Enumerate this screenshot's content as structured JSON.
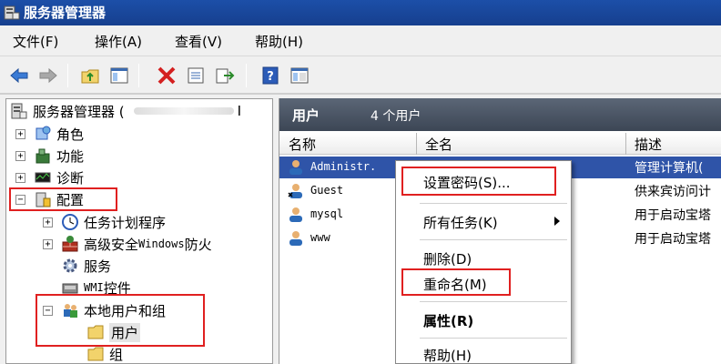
{
  "window": {
    "title": "服务器管理器"
  },
  "menubar": {
    "items": [
      "文件(F)",
      "操作(A)",
      "查看(V)",
      "帮助(H)"
    ]
  },
  "toolbar": {
    "buttons": [
      "back-arrow-icon",
      "forward-arrow-icon",
      "up-folder-icon",
      "show-hide-tree-icon",
      "delete-icon",
      "properties-icon",
      "export-icon",
      "help-icon",
      "view-icon"
    ]
  },
  "tree": {
    "root_label": "服务器管理器 (",
    "root_suffix": "I",
    "items": {
      "roles": "角色",
      "features": "功能",
      "diagnostics": "诊断",
      "configuration": "配置",
      "task_scheduler": "任务计划程序",
      "advanced_firewall_prefix": "高级安全 ",
      "advanced_firewall_mono": "Windows",
      "advanced_firewall_suffix": " 防火",
      "services": "服务",
      "wmi_prefix": "WMI",
      "wmi_suffix": " 控件",
      "local_users_groups": "本地用户和组",
      "users": "用户",
      "groups": "组"
    }
  },
  "right_pane": {
    "header_title": "用户",
    "header_count": "4 个用户",
    "columns": [
      "名称",
      "全名",
      "描述"
    ],
    "rows": [
      {
        "name": "Administr.",
        "description": "管理计算机(",
        "selected": true
      },
      {
        "name": "Guest",
        "description": "供来宾访问计",
        "selected": false
      },
      {
        "name": "mysql",
        "description": "用于启动宝塔",
        "selected": false
      },
      {
        "name": "www",
        "description": "用于启动宝塔",
        "selected": false
      }
    ]
  },
  "context_menu": {
    "items": [
      {
        "label": "设置密码(S)...",
        "bold": false,
        "submenu": false
      },
      {
        "label": "所有任务(K)",
        "bold": false,
        "submenu": true
      },
      {
        "label": "删除(D)",
        "bold": false,
        "submenu": false
      },
      {
        "label": "重命名(M)",
        "bold": false,
        "submenu": false
      },
      {
        "label": "属性(R)",
        "bold": true,
        "submenu": false
      },
      {
        "label": "帮助(H)",
        "bold": false,
        "submenu": false
      }
    ]
  },
  "colors": {
    "titlebar": "#1c4fa8",
    "selection": "#2f54a8",
    "highlight_box": "#e02020",
    "pane_header": "#4a5566"
  }
}
